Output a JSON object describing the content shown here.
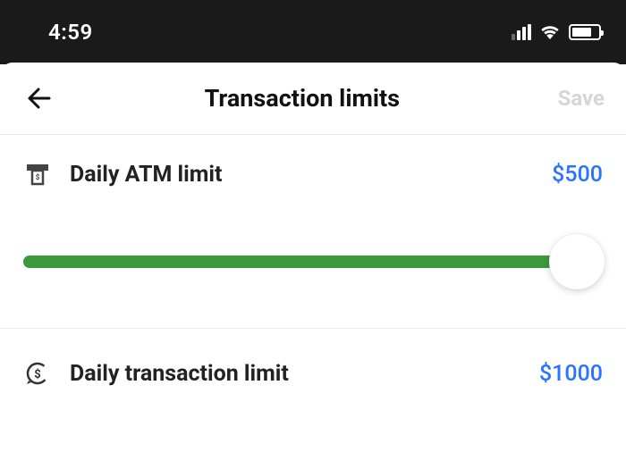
{
  "status": {
    "time": "4:59"
  },
  "header": {
    "title": "Transaction limits",
    "save_label": "Save"
  },
  "atm": {
    "label": "Daily ATM limit",
    "value": "$500"
  },
  "transaction": {
    "label": "Daily transaction limit",
    "value": "$1000"
  }
}
